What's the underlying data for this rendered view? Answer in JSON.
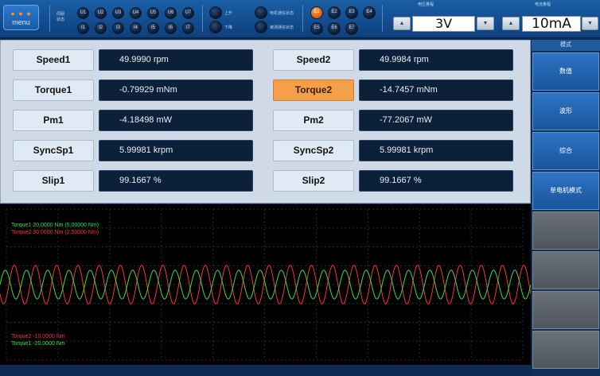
{
  "toolbar": {
    "menu_label": "menu",
    "status_label": "伺服\n状态",
    "u_leds": [
      {
        "label": "U1",
        "on": false
      },
      {
        "label": "U2",
        "on": false
      },
      {
        "label": "U3",
        "on": false
      },
      {
        "label": "U4",
        "on": false
      },
      {
        "label": "U5",
        "on": false
      },
      {
        "label": "U6",
        "on": false
      },
      {
        "label": "U7",
        "on": false
      }
    ],
    "i_leds": [
      {
        "label": "I1",
        "on": false
      },
      {
        "label": "I2",
        "on": false
      },
      {
        "label": "I3",
        "on": false
      },
      {
        "label": "I4",
        "on": false
      },
      {
        "label": "I5",
        "on": false
      },
      {
        "label": "I6",
        "on": false
      },
      {
        "label": "I7",
        "on": false
      }
    ],
    "indicators": [
      {
        "label": "上升",
        "on": false
      },
      {
        "label": "下降",
        "on": false
      },
      {
        "label": "电机通信状态",
        "on": false
      },
      {
        "label": "被测通信状态",
        "on": false
      }
    ],
    "e_leds": [
      {
        "label": "E1",
        "on": true
      },
      {
        "label": "E2",
        "on": false
      },
      {
        "label": "E3",
        "on": false
      },
      {
        "label": "E4",
        "on": false
      },
      {
        "label": "E5",
        "on": false
      },
      {
        "label": "E6",
        "on": false
      },
      {
        "label": "E7",
        "on": false
      }
    ],
    "voltage_range": {
      "title": "电压量程",
      "value": "3V"
    },
    "current_range": {
      "title": "电流量程",
      "value": "10mA"
    }
  },
  "readouts": {
    "left": [
      {
        "label": "Speed1",
        "value": "49.9990 rpm",
        "active": false
      },
      {
        "label": "Torque1",
        "value": "-0.79929 mNm",
        "active": false
      },
      {
        "label": "Pm1",
        "value": "-4.18498 mW",
        "active": false
      },
      {
        "label": "SyncSp1",
        "value": "5.99981 krpm",
        "active": false
      },
      {
        "label": "Slip1",
        "value": "99.1667  %",
        "active": false
      }
    ],
    "right": [
      {
        "label": "Speed2",
        "value": "49.9984 rpm",
        "active": false
      },
      {
        "label": "Torque2",
        "value": "-14.7457 mNm",
        "active": true
      },
      {
        "label": "Pm2",
        "value": "-77.2067 mW",
        "active": false
      },
      {
        "label": "SyncSp2",
        "value": "5.99981 krpm",
        "active": false
      },
      {
        "label": "Slip2",
        "value": "99.1667  %",
        "active": false
      }
    ]
  },
  "sidebar": {
    "header": "模式",
    "buttons": [
      "数值",
      "波形",
      "综合",
      "单电机模式"
    ]
  },
  "chart_data": {
    "type": "line",
    "title": "",
    "xlabel": "",
    "ylabel": "",
    "ylim": [
      -20,
      20
    ],
    "grid": true,
    "legend": "top-left",
    "legend_top": [
      "Torque1  20.0000 Nm (5.00000 Nm)",
      "Torque2  30.0000 Nm (2.50000 Nm)"
    ],
    "legend_bottom": [
      "Torque2  -10.0000 Nm",
      "Torque1  -20.0000 Nm"
    ],
    "series": [
      {
        "name": "Torque1",
        "color": "#2fe04a",
        "cycles": 25,
        "amplitude_fraction": 0.09
      },
      {
        "name": "Torque2",
        "color": "#ff3030",
        "cycles": 25,
        "amplitude_fraction": 0.12
      }
    ]
  },
  "colors": {
    "active_label": "#f4a04a",
    "value_bg": "#0c2039",
    "trace1": "#2fe04a",
    "trace2": "#ff3030"
  }
}
